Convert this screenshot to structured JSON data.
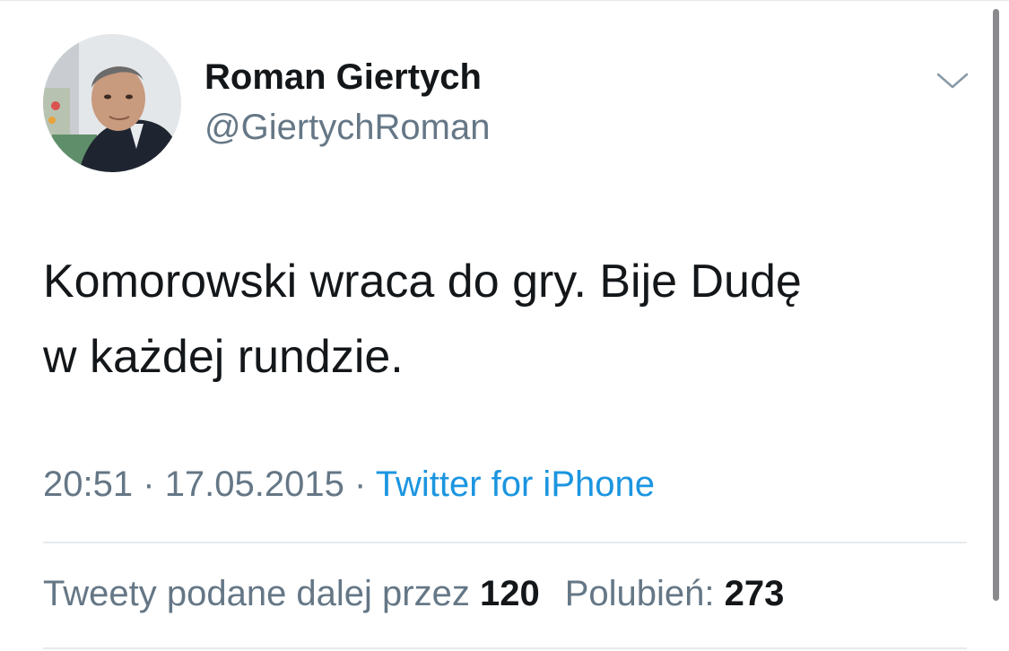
{
  "tweet": {
    "author": {
      "display_name": "Roman Giertych",
      "handle": "@GiertychRoman"
    },
    "text": "Komorowski wraca do gry. Bije Dudę\nw każdej rundzie.",
    "time": "20:51",
    "separator": "·",
    "date": "17.05.2015",
    "source": "Twitter for iPhone",
    "retweets": {
      "label": "Tweety podane dalej przez",
      "count": "120"
    },
    "likes": {
      "label": "Polubień:",
      "count": "273"
    }
  },
  "icons": {
    "menu": "chevron-down-icon"
  },
  "colors": {
    "text": "#14171a",
    "secondary": "#657786",
    "link": "#1b95e0",
    "divider": "#e6e9ec"
  }
}
